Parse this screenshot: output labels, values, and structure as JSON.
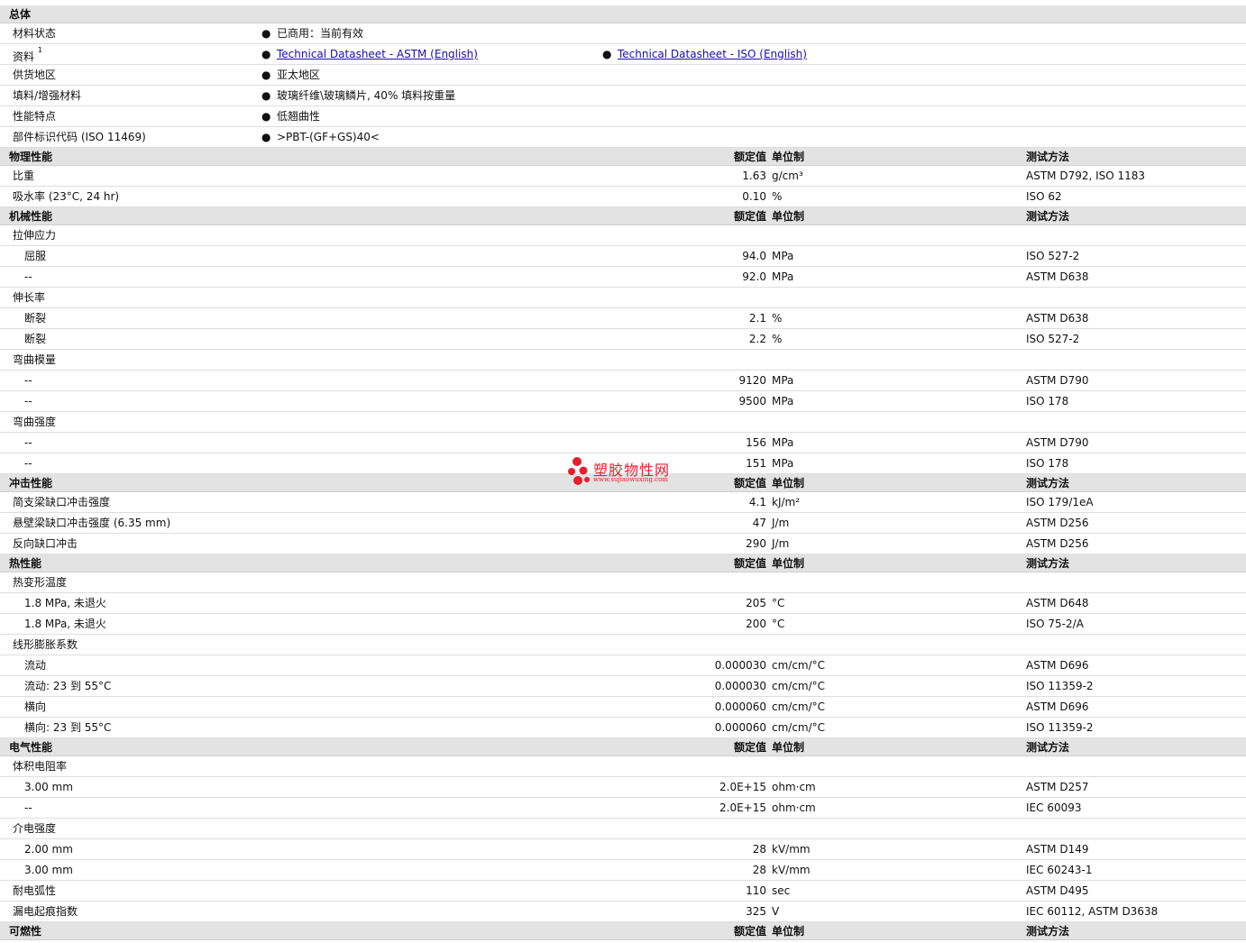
{
  "general": {
    "section_title": "总体",
    "material_status": {
      "label": "材料状态",
      "value": "已商用：当前有效"
    },
    "literature": {
      "label": "资料",
      "footnote": "1",
      "links": [
        "Technical Datasheet - ASTM (English)",
        "Technical Datasheet - ISO (English)"
      ]
    },
    "availability": {
      "label": "供货地区",
      "value": "亚太地区"
    },
    "filler": {
      "label": "填料/增强材料",
      "value": "玻璃纤维\\玻璃鳞片, 40% 填料按重量"
    },
    "features": {
      "label": "性能特点",
      "value": "低翘曲性"
    },
    "part_code": {
      "label": "部件标识代码",
      "note": "(ISO 11469)",
      "value": ">PBT-(GF+GS)40<"
    },
    "bullet": "●"
  },
  "headers": {
    "nominal": "额定值",
    "unit": "单位制",
    "method": "测试方法"
  },
  "sections": [
    {
      "title": "物理性能",
      "rows": [
        {
          "label": "比重",
          "value": "1.63",
          "unit": "g/cm³",
          "method": "ASTM D792, ISO 1183"
        },
        {
          "label": "吸水率",
          "note": "(23°C, 24 hr)",
          "value": "0.10",
          "unit": "%",
          "method": "ISO 62"
        }
      ]
    },
    {
      "title": "机械性能",
      "rows": [
        {
          "label": "拉伸应力"
        },
        {
          "label": "屈服",
          "sub": true,
          "value": "94.0",
          "unit": "MPa",
          "method": "ISO 527-2"
        },
        {
          "label": "--",
          "sub": true,
          "value": "92.0",
          "unit": "MPa",
          "method": "ASTM D638"
        },
        {
          "label": "伸长率"
        },
        {
          "label": "断裂",
          "sub": true,
          "value": "2.1",
          "unit": "%",
          "method": "ASTM D638"
        },
        {
          "label": "断裂",
          "sub": true,
          "value": "2.2",
          "unit": "%",
          "method": "ISO 527-2"
        },
        {
          "label": "弯曲模量"
        },
        {
          "label": "--",
          "sub": true,
          "value": "9120",
          "unit": "MPa",
          "method": "ASTM D790"
        },
        {
          "label": "--",
          "sub": true,
          "value": "9500",
          "unit": "MPa",
          "method": "ISO 178"
        },
        {
          "label": "弯曲强度"
        },
        {
          "label": "--",
          "sub": true,
          "value": "156",
          "unit": "MPa",
          "method": "ASTM D790"
        },
        {
          "label": "--",
          "sub": true,
          "value": "151",
          "unit": "MPa",
          "method": "ISO 178"
        }
      ]
    },
    {
      "title": "冲击性能",
      "rows": [
        {
          "label": "简支梁缺口冲击强度",
          "value": "4.1",
          "unit": "kJ/m²",
          "method": "ISO 179/1eA"
        },
        {
          "label": "悬壁梁缺口冲击强度",
          "note": "(6.35 mm)",
          "value": "47",
          "unit": "J/m",
          "method": "ASTM D256"
        },
        {
          "label": "反向缺口冲击",
          "value": "290",
          "unit": "J/m",
          "method": "ASTM D256"
        }
      ]
    },
    {
      "title": "热性能",
      "rows": [
        {
          "label": "热变形温度"
        },
        {
          "label": "1.8 MPa, 未退火",
          "sub": true,
          "value": "205",
          "unit": "°C",
          "method": "ASTM D648"
        },
        {
          "label": "1.8 MPa, 未退火",
          "sub": true,
          "value": "200",
          "unit": "°C",
          "method": "ISO 75-2/A"
        },
        {
          "label": "线形膨胀系数"
        },
        {
          "label": "流动",
          "sub": true,
          "value": "0.000030",
          "unit": "cm/cm/°C",
          "method": "ASTM D696"
        },
        {
          "label": "流动: 23 到  55°C",
          "sub": true,
          "value": "0.000030",
          "unit": "cm/cm/°C",
          "method": "ISO 11359-2"
        },
        {
          "label": "横向",
          "sub": true,
          "value": "0.000060",
          "unit": "cm/cm/°C",
          "method": "ASTM D696"
        },
        {
          "label": "横向: 23 到  55°C",
          "sub": true,
          "value": "0.000060",
          "unit": "cm/cm/°C",
          "method": "ISO 11359-2"
        }
      ]
    },
    {
      "title": "电气性能",
      "rows": [
        {
          "label": "体积电阻率"
        },
        {
          "label": "3.00 mm",
          "sub": true,
          "value": "2.0E+15",
          "unit": "ohm·cm",
          "method": "ASTM D257"
        },
        {
          "label": "--",
          "sub": true,
          "value": "2.0E+15",
          "unit": "ohm·cm",
          "method": "IEC 60093"
        },
        {
          "label": "介电强度"
        },
        {
          "label": "2.00 mm",
          "sub": true,
          "value": "28",
          "unit": "kV/mm",
          "method": "ASTM D149"
        },
        {
          "label": "3.00 mm",
          "sub": true,
          "value": "28",
          "unit": "kV/mm",
          "method": "IEC 60243-1"
        },
        {
          "label": "耐电弧性",
          "value": "110",
          "unit": "sec",
          "method": "ASTM D495"
        },
        {
          "label": "漏电起痕指数",
          "value": "325",
          "unit": "V",
          "method": "IEC 60112, ASTM D3638"
        }
      ]
    },
    {
      "title": "可燃性",
      "rows": []
    }
  ],
  "watermark": {
    "title": "塑胶物性网",
    "url": "www.sujiaowuxing.com",
    "color": "#e4202e"
  }
}
